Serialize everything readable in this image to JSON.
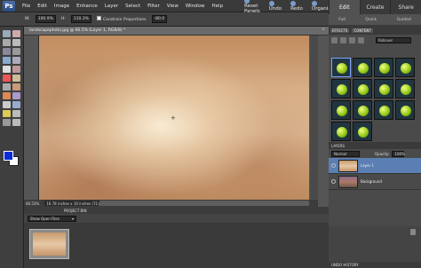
{
  "app": {
    "logo": "Ps"
  },
  "menu": {
    "items": [
      "File",
      "Edit",
      "Image",
      "Enhance",
      "Layer",
      "Select",
      "Filter",
      "View",
      "Window",
      "Help"
    ]
  },
  "quickbar": {
    "reset": "Reset Panels",
    "undo": "Undo",
    "redo": "Redo",
    "organizer": "Organizer"
  },
  "right_tabs": {
    "tabs": [
      "Edit",
      "Create",
      "Share"
    ],
    "active": "Edit",
    "subtabs": [
      "Full",
      "Quick",
      "Guided"
    ]
  },
  "options": {
    "width": "100.9%",
    "height": "110.3%",
    "constrain": "Constrain Proportions",
    "angle": "-80.0"
  },
  "document": {
    "title": "landscapephoto.jpg @ 66.5% (Layer 1, RGB/8) *",
    "close": "×",
    "zoom": "66.53%",
    "doc_info": "16.78 inches x 10 inches (72 ppi)"
  },
  "project_bin": {
    "header": "PROJECT BIN",
    "selector": "Show Open Files"
  },
  "effects": {
    "tab1": "EFFECTS",
    "tab2": "CONTENT",
    "dropdown": "Rollover"
  },
  "layers": {
    "header": "LAYERS",
    "blend": "Normal",
    "opacity_label": "Opacity:",
    "opacity": "100%",
    "items": [
      {
        "name": "Layer 1"
      },
      {
        "name": "Background"
      }
    ]
  },
  "undo_history": {
    "header": "UNDO HISTORY"
  },
  "colors": {
    "foreground": "#0a2bd8",
    "background": "#ffffff",
    "accent": "#5b7fb3"
  }
}
